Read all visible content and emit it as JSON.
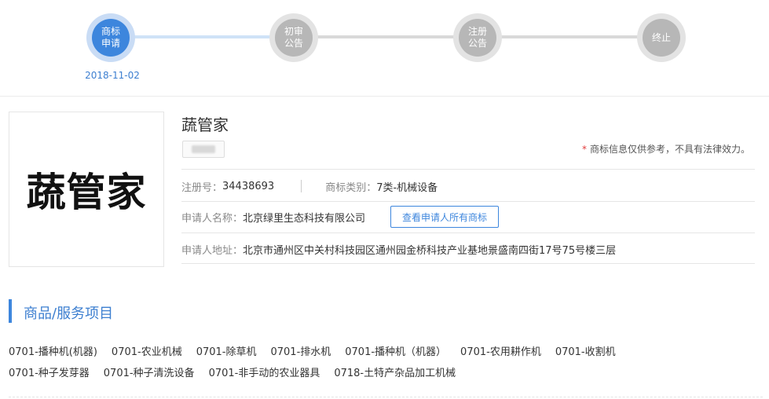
{
  "progress": {
    "steps": [
      {
        "label": "商标\n申请",
        "status": "done",
        "date": "2018-11-02"
      },
      {
        "label": "初审\n公告",
        "status": "todo"
      },
      {
        "label": "注册\n公告",
        "status": "todo"
      },
      {
        "label": "终止",
        "status": "todo"
      }
    ]
  },
  "trademark": {
    "image_text": "蔬管家",
    "name": "蔬管家",
    "disclaimer_star": "*",
    "disclaimer": "商标信息仅供参考，不具有法律效力。",
    "reg_no_label": "注册号：",
    "reg_no": "34438693",
    "category_label": "商标类别：",
    "category": "7类-机械设备",
    "applicant_label": "申请人名称：",
    "applicant": "北京绿里生态科技有限公司",
    "view_all_button": "查看申请人所有商标",
    "address_label": "申请人地址：",
    "address": "北京市通州区中关村科技园区通州园金桥科技产业基地景盛南四街17号75号楼三层"
  },
  "goods_section": {
    "title": "商品/服务项目",
    "row1": [
      "0701-播种机(机器)",
      "0701-农业机械",
      "0701-除草机",
      "0701-排水机",
      "0701-播种机（机器）",
      "0701-农用耕作机",
      "0701-收割机"
    ],
    "row2": [
      "0701-种子发芽器",
      "0701-种子清洗设备",
      "0701-非手动的农业器具",
      "0718-土特产杂品加工机械"
    ]
  },
  "colors": {
    "accent": "#3d86dd",
    "star": "#e23d3d"
  }
}
